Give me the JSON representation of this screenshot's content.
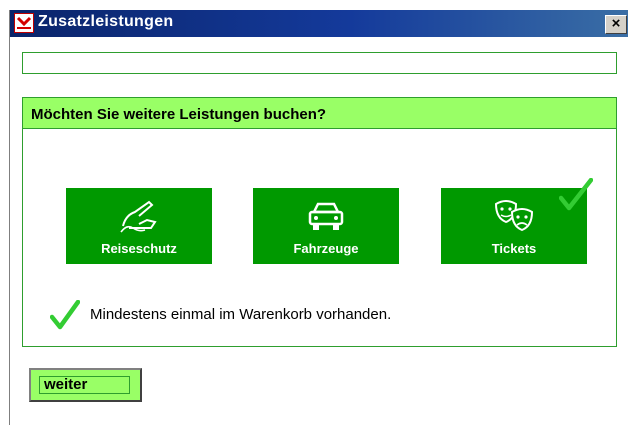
{
  "window": {
    "title": "Zusatzleistungen",
    "close_label": "×"
  },
  "panel": {
    "heading": "Möchten Sie weitere Leistungen buchen?"
  },
  "tiles": [
    {
      "label": "Reiseschutz",
      "icon": "signature-hand-icon",
      "selected": false
    },
    {
      "label": "Fahrzeuge",
      "icon": "car-icon",
      "selected": false
    },
    {
      "label": "Tickets",
      "icon": "theater-masks-icon",
      "selected": true
    }
  ],
  "info": {
    "text": "Mindestens einmal im Warenkorb vorhanden."
  },
  "actions": {
    "weiter_label": "weiter"
  },
  "colors": {
    "accent_green": "#009900",
    "light_green": "#99ff66",
    "check_green": "#33cc33",
    "titlebar_blue": "#0a246a"
  }
}
